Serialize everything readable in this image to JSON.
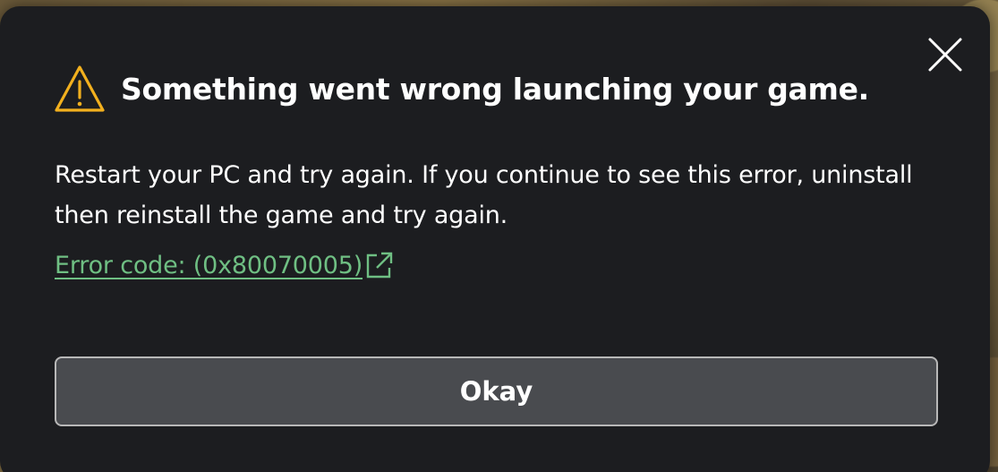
{
  "dialog": {
    "title": "Something went wrong launching your game.",
    "message": "Restart your PC and try again. If you continue to see this error, uninstall then reinstall the game and try again.",
    "error_link": "Error code: (0x80070005)",
    "okay_label": "Okay",
    "icons": {
      "warning": "warning-triangle-icon",
      "close": "close-icon",
      "external_link": "external-link-icon"
    },
    "colors": {
      "background": "#1c1d20",
      "warning": "#f2b01e",
      "link": "#6fbf83",
      "button": "#494b4f",
      "button_border": "#b8b8b8"
    }
  }
}
